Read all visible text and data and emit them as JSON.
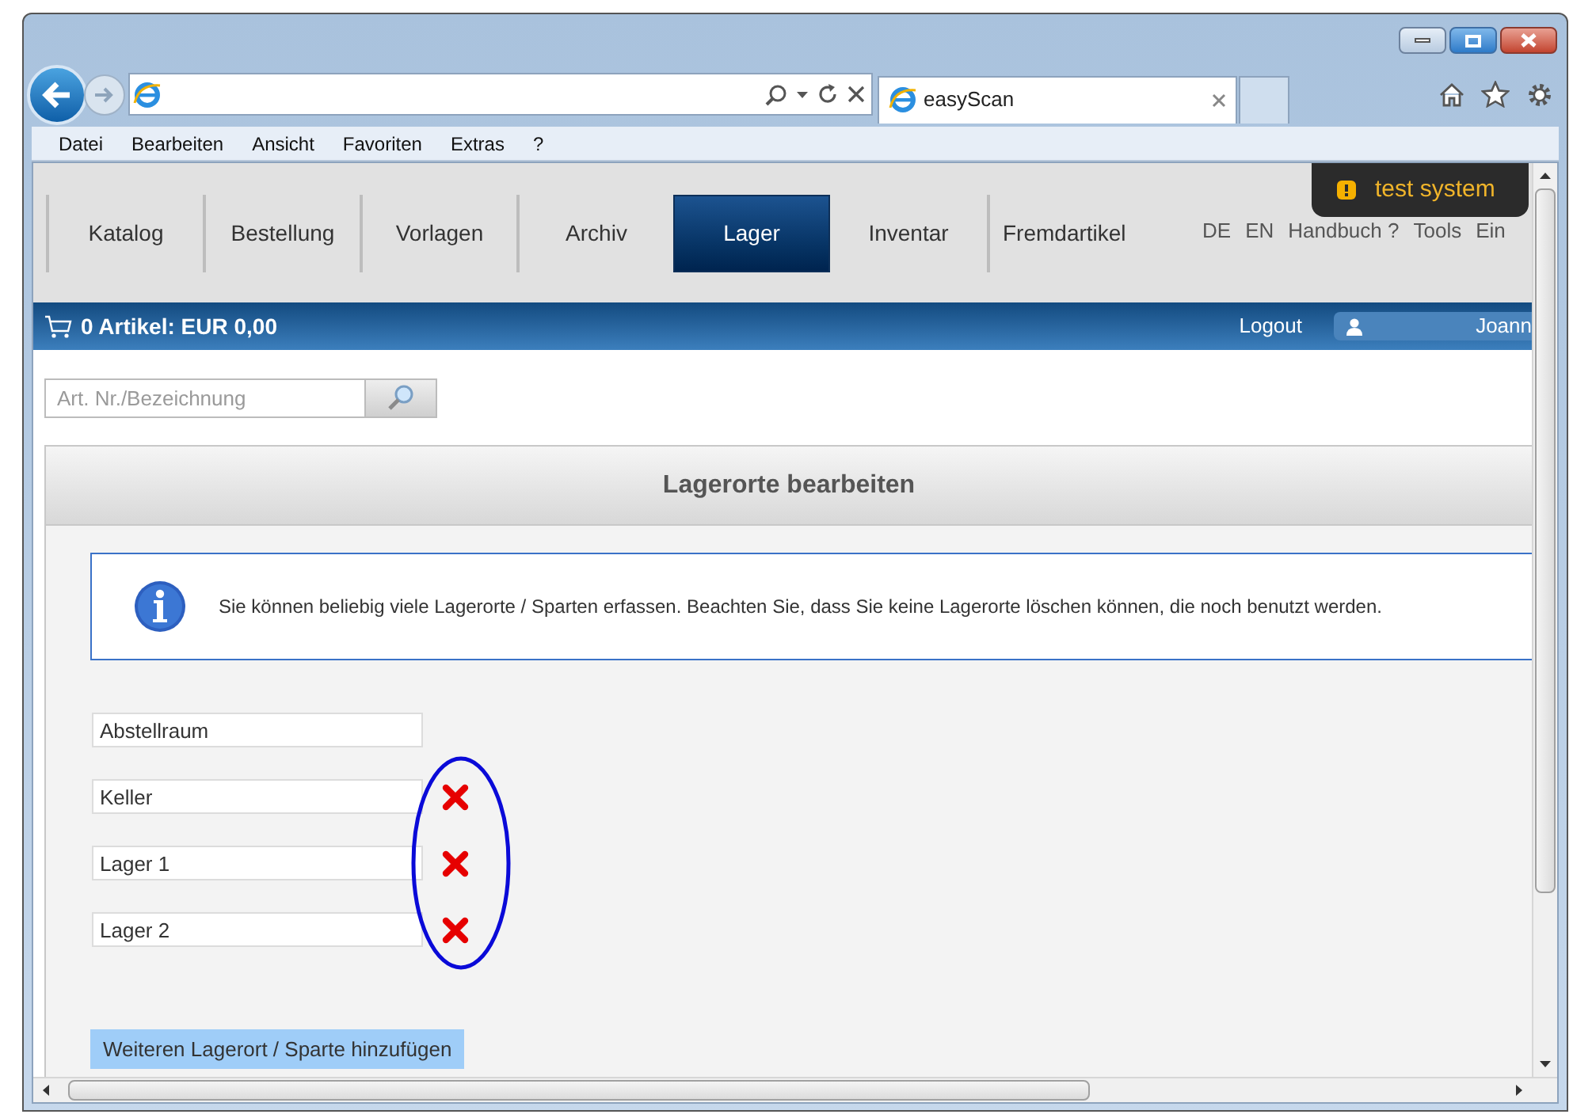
{
  "browser": {
    "tab_title": "easyScan",
    "menu": [
      "Datei",
      "Bearbeiten",
      "Ansicht",
      "Favoriten",
      "Extras",
      "?"
    ]
  },
  "nav": {
    "items": [
      {
        "label": "Katalog",
        "selected": false
      },
      {
        "label": "Bestellung",
        "selected": false
      },
      {
        "label": "Vorlagen",
        "selected": false
      },
      {
        "label": "Archiv",
        "selected": false
      },
      {
        "label": "Lager",
        "selected": true
      },
      {
        "label": "Inventar",
        "selected": false
      },
      {
        "label": "Fremdartikel",
        "selected": false
      }
    ],
    "links": [
      "DE",
      "EN",
      "Handbuch ?",
      "Tools",
      "Ein"
    ]
  },
  "badge": "test system",
  "cart": "0 Artikel: EUR 0,00",
  "logout": "Logout",
  "user": "Joann",
  "search": {
    "placeholder": "Art. Nr./Bezeichnung"
  },
  "section": {
    "title": "Lagerorte bearbeiten",
    "info": "Sie können beliebig viele Lagerorte / Sparten erfassen. Beachten Sie, dass Sie keine Lagerorte löschen können, die noch benutzt werden.",
    "locations": [
      {
        "value": "Abstellraum",
        "deletable": false
      },
      {
        "value": "Keller",
        "deletable": true
      },
      {
        "value": "Lager 1",
        "deletable": true
      },
      {
        "value": "Lager 2",
        "deletable": true
      }
    ],
    "add_button": "Weiteren Lagerort / Sparte hinzufügen"
  }
}
